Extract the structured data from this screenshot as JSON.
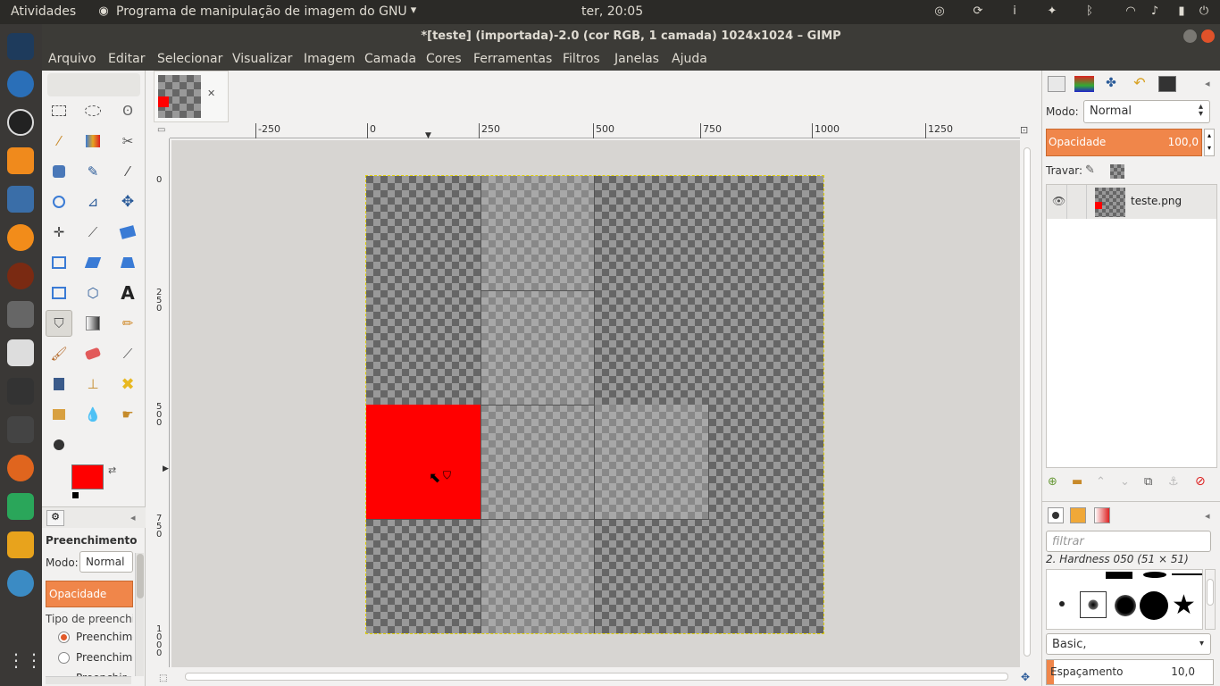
{
  "top_panel": {
    "activities": "Atividades",
    "app_menu": "Programa de manipulação de imagem do GNU",
    "clock": "ter, 20:05"
  },
  "window": {
    "title": "*[teste] (importada)-2.0 (cor RGB, 1 camada) 1024x1024 – GIMP"
  },
  "menubar": [
    "Arquivo",
    "Editar",
    "Selecionar",
    "Visualizar",
    "Imagem",
    "Camada",
    "Cores",
    "Ferramentas",
    "Filtros",
    "Janelas",
    "Ajuda"
  ],
  "hruler": [
    "-250",
    "0",
    "250",
    "500",
    "750",
    "1000",
    "1250"
  ],
  "vruler": [
    "0",
    "2\n5\n0",
    "5\n0\n0",
    "7\n5\n0",
    "1\n0\n0\n0"
  ],
  "tool_options": {
    "title": "Preenchimento",
    "mode_label": "Modo:",
    "mode_value": "Normal",
    "opacity_label": "Opacidade",
    "fill_type_label": "Tipo de preenchir",
    "options": [
      "Preenchime",
      "Preenchime",
      "Preenchir"
    ]
  },
  "layers": {
    "mode_label": "Modo:",
    "mode_value": "Normal",
    "opacity_label": "Opacidade",
    "opacity_value": "100,0",
    "lock_label": "Travar:",
    "layer_name": "teste.png"
  },
  "brushes": {
    "filter_placeholder": "filtrar",
    "current": "2. Hardness 050 (51 × 51)",
    "tag": "Basic,",
    "spacing_label": "Espaçamento",
    "spacing_value": "10,0"
  },
  "colors": {
    "fg": "#ff0000",
    "bg": "#ffffff",
    "accent": "#f0864a"
  }
}
